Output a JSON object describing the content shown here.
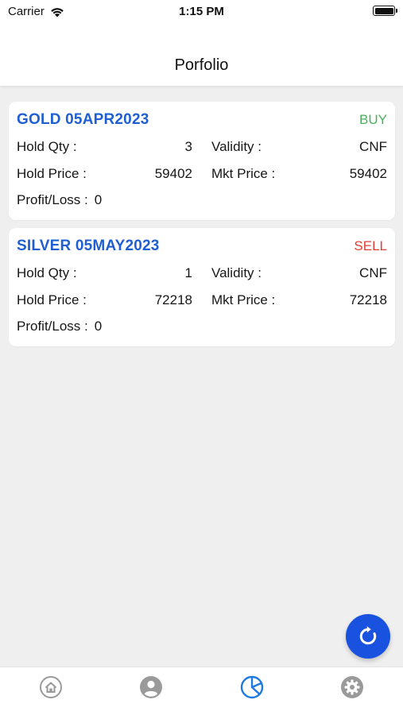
{
  "status_bar": {
    "carrier": "Carrier",
    "time": "1:15 PM"
  },
  "nav": {
    "title": "Porfolio"
  },
  "labels": {
    "hold_qty": "Hold Qty :",
    "validity": "Validity :",
    "hold_price": "Hold Price :",
    "mkt_price": "Mkt Price :",
    "profit_loss": "Profit/Loss :"
  },
  "positions": [
    {
      "symbol": "GOLD 05APR2023",
      "side": "BUY",
      "hold_qty": "3",
      "validity": "CNF",
      "hold_price": "59402",
      "mkt_price": "59402",
      "profit_loss": "0"
    },
    {
      "symbol": "SILVER 05MAY2023",
      "side": "SELL",
      "hold_qty": "1",
      "validity": "CNF",
      "hold_price": "72218",
      "mkt_price": "72218",
      "profit_loss": "0"
    }
  ],
  "tabs": [
    {
      "icon": "home-icon",
      "active": false
    },
    {
      "icon": "user-icon",
      "active": false
    },
    {
      "icon": "pie-chart-icon",
      "active": true
    },
    {
      "icon": "gear-icon",
      "active": false
    }
  ],
  "colors": {
    "accent": "#1a52e0",
    "symbol": "#1f5fd1",
    "buy": "#4cb05a",
    "sell": "#e53d34",
    "tab_inactive": "#9a9a9a",
    "tab_active": "#1f7ae0"
  },
  "fab": {
    "icon": "refresh-icon"
  }
}
